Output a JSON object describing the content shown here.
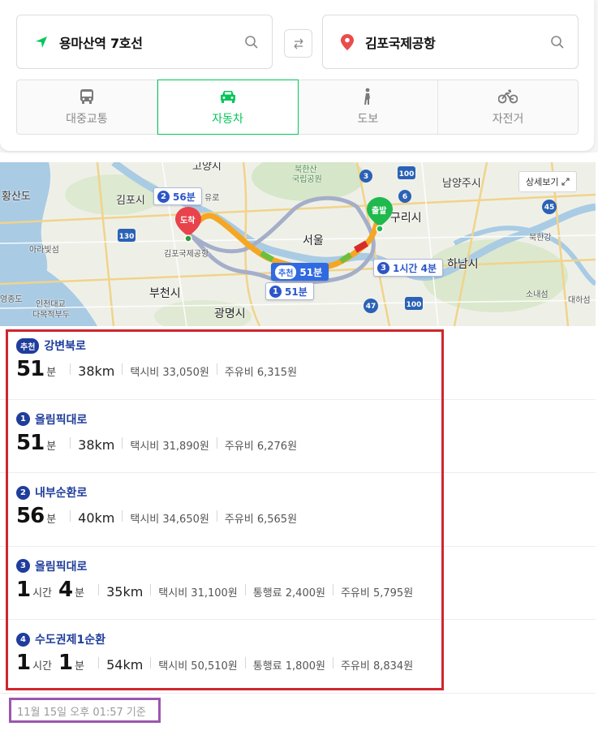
{
  "search": {
    "start": "용마산역 7호선",
    "end": "김포국제공항"
  },
  "modes": [
    {
      "label": "대중교통",
      "icon": "bus-icon",
      "active": false
    },
    {
      "label": "자동차",
      "icon": "car-icon",
      "active": true
    },
    {
      "label": "도보",
      "icon": "walk-icon",
      "active": false
    },
    {
      "label": "자전거",
      "icon": "bicycle-icon",
      "active": false
    }
  ],
  "map": {
    "detail_button": "상세보기",
    "labels": {
      "goyang": "고양시",
      "gimpo": "김포시",
      "bukhansan": "북한산",
      "national_park": "국립공원",
      "namyangju": "남양주시",
      "guri": "구리시",
      "seoul": "서울",
      "hanam": "하남시",
      "bucheon": "부천시",
      "gwangmyeong": "광명시",
      "hwangsando": "황산도",
      "arabit": "아라빛섬",
      "yeongjongdo": "영종도",
      "incheon_airport": "인천대교",
      "daroopu": "다목적부두",
      "gimpo_airport": "김포국제공항",
      "bukhangang": "북한강",
      "sonaeseom": "소내섬",
      "daehaseom": "대하섬",
      "yuro": "유로"
    },
    "highways": [
      "130",
      "100",
      "45",
      "47",
      "100",
      "3",
      "6"
    ],
    "pins": {
      "arrive": "도착",
      "depart": "출발"
    },
    "route_tags": {
      "r2": {
        "num": "2",
        "time": "56분"
      },
      "rec": {
        "chip": "추천",
        "time": "51분"
      },
      "r1": {
        "num": "1",
        "time": "51분"
      },
      "r3": {
        "num": "3",
        "time": "1시간 4분"
      }
    }
  },
  "routes": [
    {
      "badge": "추천",
      "name": "강변북로",
      "hours": "",
      "minutes": "51",
      "distance": "38km",
      "taxi": "택시비 33,050원",
      "toll": "",
      "fuel": "주유비 6,315원"
    },
    {
      "badge": "1",
      "name": "올림픽대로",
      "hours": "",
      "minutes": "51",
      "distance": "38km",
      "taxi": "택시비 31,890원",
      "toll": "",
      "fuel": "주유비 6,276원"
    },
    {
      "badge": "2",
      "name": "내부순환로",
      "hours": "",
      "minutes": "56",
      "distance": "40km",
      "taxi": "택시비 34,650원",
      "toll": "",
      "fuel": "주유비 6,565원"
    },
    {
      "badge": "3",
      "name": "올림픽대로",
      "hours": "1",
      "minutes": "4",
      "distance": "35km",
      "taxi": "택시비 31,100원",
      "toll": "통행료 2,400원",
      "fuel": "주유비 5,795원"
    },
    {
      "badge": "4",
      "name": "수도권제1순환",
      "hours": "1",
      "minutes": "1",
      "distance": "54km",
      "taxi": "택시비 50,510원",
      "toll": "통행료 1,800원",
      "fuel": "주유비 8,834원"
    }
  ],
  "units": {
    "hour": "시간",
    "minute": "분"
  },
  "timestamp": "11월 15일 오후 01:57 기준",
  "colors": {
    "brand_green": "#03c75a",
    "route_blue": "#1f3d9c",
    "highlight_red": "#d0262e",
    "highlight_purple": "#9a57b0"
  }
}
